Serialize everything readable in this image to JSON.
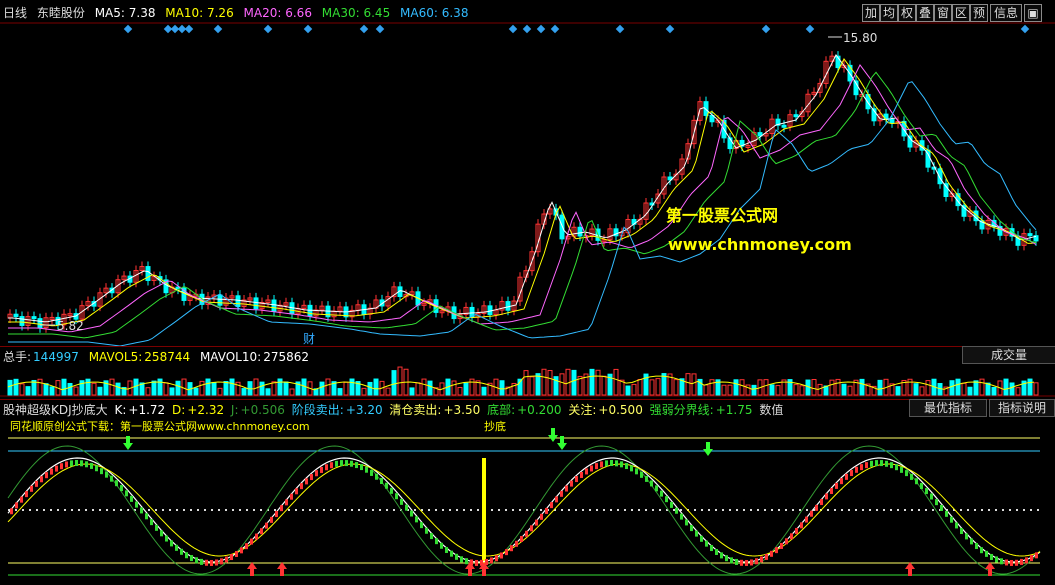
{
  "header": {
    "period": "日线",
    "stock_name": "东睦股份",
    "ma": [
      {
        "label": "MA5: 7.38",
        "color": "#ffffff"
      },
      {
        "label": "MA10: 7.26",
        "color": "#ffff00"
      },
      {
        "label": "MA20: 6.66",
        "color": "#ff66ff"
      },
      {
        "label": "MA30: 6.45",
        "color": "#33dd33"
      },
      {
        "label": "MA60: 6.38",
        "color": "#33bbff"
      }
    ],
    "buttons": [
      "加",
      "均",
      "权",
      "叠",
      "窗",
      "区",
      "预",
      "信息",
      "▣"
    ]
  },
  "price_chart": {
    "high_label": "15.80",
    "low_label": "5.82",
    "event_marker": "财",
    "watermark_cn": "第一股票公式网",
    "watermark_url": "www.chnmoney.com"
  },
  "volume_panel": {
    "total": {
      "label": "总手:",
      "value": "144997"
    },
    "mavol5": {
      "label": "MAVOL5:",
      "value": "258744"
    },
    "mavol10": {
      "label": "MAVOL10:",
      "value": "275862"
    },
    "selector": "成交量"
  },
  "indicator_panel": {
    "name": "股神超级KDJ抄底大",
    "readouts": [
      {
        "label": "K:",
        "value": "+1.72",
        "color": "#ffffff"
      },
      {
        "label": "D:",
        "value": "+2.32",
        "color": "#ffff00"
      },
      {
        "label": "J:",
        "value": "+0.506",
        "color": "#339933"
      },
      {
        "label": "阶段卖出:",
        "value": "+3.20",
        "color": "#33ccff"
      },
      {
        "label": "清仓卖出:",
        "value": "+3.50",
        "color": "#ffff66"
      },
      {
        "label": "底部:",
        "value": "+0.200",
        "color": "#33dd33"
      },
      {
        "label": "关注:",
        "value": "+0.500",
        "color": "#ffff66"
      },
      {
        "label": "强弱分界线:",
        "value": "+1.75",
        "color": "#33dd33"
      }
    ],
    "extra_label": "数值",
    "buttons": [
      "最优指标",
      "指标说明"
    ],
    "source_note": "同花顺原创公式下载：第一股票公式网www.chnmoney.com",
    "buy_label": "抄底"
  },
  "colors": {
    "up": "#ff3333",
    "down": "#00ffff",
    "grid_red": "#7a0000",
    "diamond": "#33a0ee"
  }
}
